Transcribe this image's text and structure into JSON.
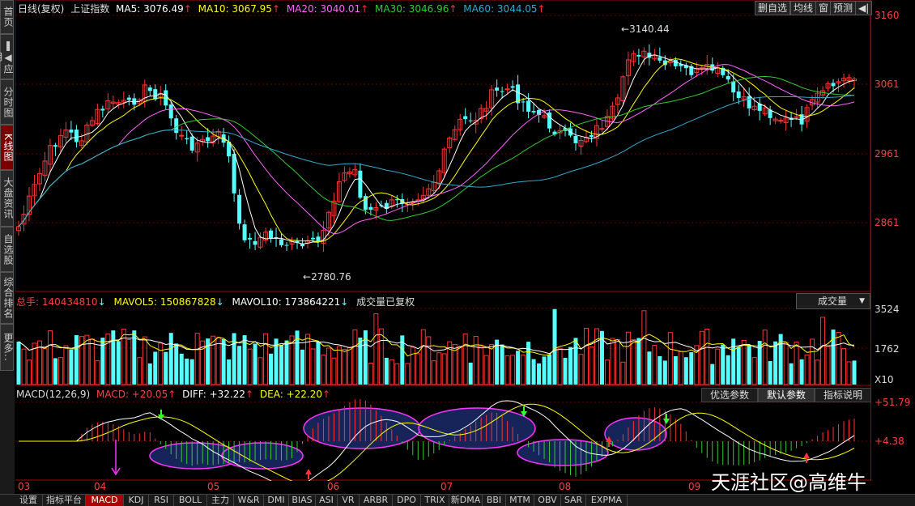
{
  "left_nav": [
    "首页",
    "❚◀应用",
    "分时图",
    "K线图",
    "大盘资讯",
    "自选股",
    "综合排名",
    "更多.."
  ],
  "legend": {
    "title": "日线(复权)",
    "index": "上证指数",
    "ma5": "MA5: 3076.49",
    "ma10": "MA10: 3067.95",
    "ma20": "MA20: 3040.01",
    "ma30": "MA30: 3046.96",
    "ma60": "MA60: 3044.05",
    "arrow_up": "↑",
    "arrow_down": "↓"
  },
  "top_buttons": [
    "删自选",
    "均线",
    "窗",
    "预测",
    "◀|"
  ],
  "price_axis": [
    "3160",
    "3061",
    "2961",
    "2861"
  ],
  "annot_high": "3140.44",
  "annot_low": "2780.76",
  "vol_legend": {
    "total": "总手: 140434810",
    "mavol5": "MAVOL5: 150867828",
    "mavol10": "MAVOL10: 173864221",
    "note": "成交量已复权"
  },
  "vol_dropdown": "成交量",
  "vol_axis": [
    "3524",
    "1762",
    "X10"
  ],
  "macd_legend": {
    "name": "MACD(12,26,9)",
    "macd": "MACD: +20.05",
    "diff": "DIFF: +32.22",
    "dea": "DEA: +22.20"
  },
  "macd_buttons": [
    "优选参数",
    "默认参数",
    "指标说明"
  ],
  "macd_axis": [
    "+51.79",
    "+4.38"
  ],
  "months": [
    "03",
    "04",
    "05",
    "06",
    "07",
    "08",
    "09"
  ],
  "bottom_tabs": [
    "设置",
    "指标平台",
    "MACD",
    "KDJ",
    "RSI",
    "BOLL",
    "主力",
    "W&R",
    "DMI",
    "BIAS",
    "ASI",
    "VR",
    "ARBR",
    "DPO",
    "TRIX",
    "新DMA",
    "BBI",
    "MTM",
    "OBV",
    "SAR",
    "EXPMA"
  ],
  "watermark": "天涯社区@高维牛",
  "colors": {
    "ma5": "#ffffff",
    "ma10": "#ffff00",
    "ma20": "#ff66ff",
    "ma30": "#33cc33",
    "ma60": "#33aacc",
    "up": "#ff3333",
    "down": "#55ffff"
  }
}
